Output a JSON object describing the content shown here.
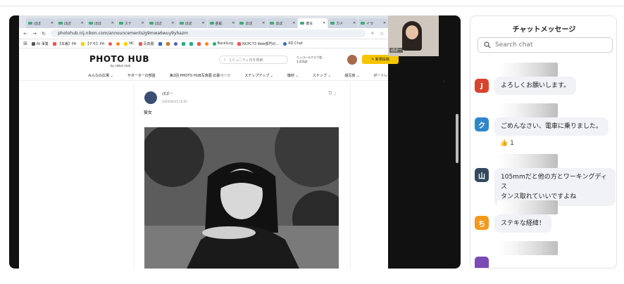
{
  "browser": {
    "tabs": [
      {
        "label": "ほぼ"
      },
      {
        "label": "ほぼ"
      },
      {
        "label": "ほぼ"
      },
      {
        "label": "ステ"
      },
      {
        "label": "ほぼ"
      },
      {
        "label": "ほぼ"
      },
      {
        "label": "金鉱"
      },
      {
        "label": "ほぼ"
      },
      {
        "label": "ほぼ"
      },
      {
        "label": "彼女"
      },
      {
        "label": "カメ"
      },
      {
        "label": "イラ"
      }
    ],
    "url": "photohub.nij.nikon.com/announcements/g9mwa6wuy9yhazm",
    "bookmarks": [
      "Ni 事業",
      "【本番】PH",
      "【デモ】PH",
      "",
      "",
      "NC",
      "写真展",
      "",
      "",
      "",
      "",
      "",
      "",
      "",
      "BacklLog",
      "NCPC73 Web部門の...",
      "KD Chat"
    ]
  },
  "site": {
    "logo": "PHOTO HUB",
    "logo_sub": "by nikkor club",
    "search_placeholder": "コミュニティ内を検索",
    "points_line1": "ニッコールクラブ会...",
    "points_line2": "1,433pt",
    "post_button": "新規投稿",
    "nav": [
      "みんなの広場 ⌄",
      "サポーターの部屋",
      "第2回 PHOTO HUB写真展 応募ページ",
      "ステップアップ ⌄",
      "機材 ⌄",
      "スナップ ⌄",
      "組写真 ⌄",
      "ポートレー"
    ],
    "post": {
      "author": "ぽぽー",
      "date": "2025/04/15 16:45",
      "title": "彼女"
    }
  },
  "camera": {
    "label": "ぽぽー"
  },
  "chat": {
    "title": "チャットメッセージ",
    "search_placeholder": "Search chat",
    "messages": [
      {
        "initial": "J",
        "color": "#d9432e",
        "text": "よろしくお願いします。"
      },
      {
        "initial": "ク",
        "color": "#2f86c9",
        "text": "ごめんなさい、電車に乗りました。",
        "reaction": "👍 1"
      },
      {
        "initial": "山",
        "color": "#334a5e",
        "text_line1": "105mmだと他の方とワーキングディス",
        "text_line2": "タンス取れていいですよね"
      },
      {
        "initial": "ち",
        "color": "#f39a1c",
        "text": "ステキな経緯！"
      },
      {
        "initial": "",
        "color": "#7a4ab5"
      }
    ]
  }
}
